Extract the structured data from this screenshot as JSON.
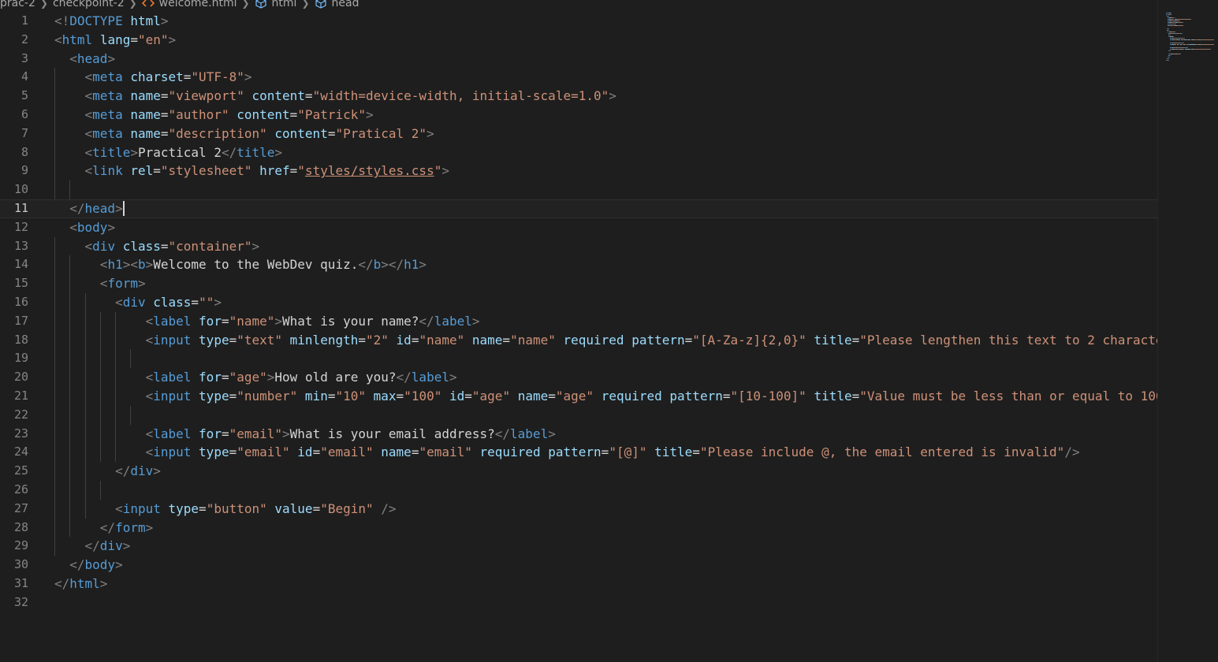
{
  "breadcrumb": [
    "prac-2",
    "checkpoint-2",
    "welcome.html",
    "html",
    "head"
  ],
  "icons": {
    "file": "html-file-icon",
    "symbol": "symbol-box-icon",
    "separator": "chevron-right-icon"
  },
  "colors": {
    "tag": "#569cd6",
    "attribute": "#9cdcfe",
    "string": "#ce9178",
    "text": "#d4d4d4",
    "bracket": "#808080",
    "background": "#1e1e1e"
  },
  "editor": {
    "active_line": 11,
    "lines": [
      [
        [
          "br",
          "<!"
        ],
        [
          "tag",
          "DOCTYPE"
        ],
        [
          "txt",
          " "
        ],
        [
          "attr",
          "html"
        ],
        [
          "br",
          ">"
        ]
      ],
      [
        [
          "br",
          "<"
        ],
        [
          "tag",
          "html"
        ],
        [
          "txt",
          " "
        ],
        [
          "attr",
          "lang"
        ],
        [
          "txt",
          "="
        ],
        [
          "str",
          "\"en\""
        ],
        [
          "br",
          ">"
        ]
      ],
      [
        [
          "txt",
          "  "
        ],
        [
          "br",
          "<"
        ],
        [
          "tag",
          "head"
        ],
        [
          "br",
          ">"
        ]
      ],
      [
        [
          "txt",
          "    "
        ],
        [
          "br",
          "<"
        ],
        [
          "tag",
          "meta"
        ],
        [
          "txt",
          " "
        ],
        [
          "attr",
          "charset"
        ],
        [
          "txt",
          "="
        ],
        [
          "str",
          "\"UTF-8\""
        ],
        [
          "br",
          ">"
        ]
      ],
      [
        [
          "txt",
          "    "
        ],
        [
          "br",
          "<"
        ],
        [
          "tag",
          "meta"
        ],
        [
          "txt",
          " "
        ],
        [
          "attr",
          "name"
        ],
        [
          "txt",
          "="
        ],
        [
          "str",
          "\"viewport\""
        ],
        [
          "txt",
          " "
        ],
        [
          "attr",
          "content"
        ],
        [
          "txt",
          "="
        ],
        [
          "str",
          "\"width=device-width, initial-scale=1.0\""
        ],
        [
          "br",
          ">"
        ]
      ],
      [
        [
          "txt",
          "    "
        ],
        [
          "br",
          "<"
        ],
        [
          "tag",
          "meta"
        ],
        [
          "txt",
          " "
        ],
        [
          "attr",
          "name"
        ],
        [
          "txt",
          "="
        ],
        [
          "str",
          "\"author\""
        ],
        [
          "txt",
          " "
        ],
        [
          "attr",
          "content"
        ],
        [
          "txt",
          "="
        ],
        [
          "str",
          "\"Patrick\""
        ],
        [
          "br",
          ">"
        ]
      ],
      [
        [
          "txt",
          "    "
        ],
        [
          "br",
          "<"
        ],
        [
          "tag",
          "meta"
        ],
        [
          "txt",
          " "
        ],
        [
          "attr",
          "name"
        ],
        [
          "txt",
          "="
        ],
        [
          "str",
          "\"description\""
        ],
        [
          "txt",
          " "
        ],
        [
          "attr",
          "content"
        ],
        [
          "txt",
          "="
        ],
        [
          "str",
          "\"Pratical 2\""
        ],
        [
          "br",
          ">"
        ]
      ],
      [
        [
          "txt",
          "    "
        ],
        [
          "br",
          "<"
        ],
        [
          "tag",
          "title"
        ],
        [
          "br",
          ">"
        ],
        [
          "txt",
          "Practical 2"
        ],
        [
          "br",
          "</"
        ],
        [
          "tag",
          "title"
        ],
        [
          "br",
          ">"
        ]
      ],
      [
        [
          "txt",
          "    "
        ],
        [
          "br",
          "<"
        ],
        [
          "tag",
          "link"
        ],
        [
          "txt",
          " "
        ],
        [
          "attr",
          "rel"
        ],
        [
          "txt",
          "="
        ],
        [
          "str",
          "\"stylesheet\""
        ],
        [
          "txt",
          " "
        ],
        [
          "attr",
          "href"
        ],
        [
          "txt",
          "="
        ],
        [
          "str",
          "\""
        ],
        [
          "link",
          "styles/styles.css"
        ],
        [
          "str",
          "\""
        ],
        [
          "br",
          ">"
        ]
      ],
      [],
      [
        [
          "txt",
          "  "
        ],
        [
          "br",
          "</"
        ],
        [
          "tag",
          "head"
        ],
        [
          "br",
          ">"
        ],
        [
          "caret",
          ""
        ]
      ],
      [
        [
          "txt",
          "  "
        ],
        [
          "br",
          "<"
        ],
        [
          "tag",
          "body"
        ],
        [
          "br",
          ">"
        ]
      ],
      [
        [
          "txt",
          "    "
        ],
        [
          "br",
          "<"
        ],
        [
          "tag",
          "div"
        ],
        [
          "txt",
          " "
        ],
        [
          "attr",
          "class"
        ],
        [
          "txt",
          "="
        ],
        [
          "str",
          "\"container\""
        ],
        [
          "br",
          ">"
        ]
      ],
      [
        [
          "txt",
          "      "
        ],
        [
          "br",
          "<"
        ],
        [
          "tag",
          "h1"
        ],
        [
          "br",
          "><"
        ],
        [
          "tag",
          "b"
        ],
        [
          "br",
          ">"
        ],
        [
          "txt",
          "Welcome to the WebDev quiz."
        ],
        [
          "br",
          "</"
        ],
        [
          "tag",
          "b"
        ],
        [
          "br",
          "></"
        ],
        [
          "tag",
          "h1"
        ],
        [
          "br",
          ">"
        ]
      ],
      [
        [
          "txt",
          "      "
        ],
        [
          "br",
          "<"
        ],
        [
          "tag",
          "form"
        ],
        [
          "br",
          ">"
        ]
      ],
      [
        [
          "txt",
          "        "
        ],
        [
          "br",
          "<"
        ],
        [
          "tag",
          "div"
        ],
        [
          "txt",
          " "
        ],
        [
          "attr",
          "class"
        ],
        [
          "txt",
          "="
        ],
        [
          "str",
          "\"\""
        ],
        [
          "br",
          ">"
        ]
      ],
      [
        [
          "txt",
          "            "
        ],
        [
          "br",
          "<"
        ],
        [
          "tag",
          "label"
        ],
        [
          "txt",
          " "
        ],
        [
          "attr",
          "for"
        ],
        [
          "txt",
          "="
        ],
        [
          "str",
          "\"name\""
        ],
        [
          "br",
          ">"
        ],
        [
          "txt",
          "What is your name?"
        ],
        [
          "br",
          "</"
        ],
        [
          "tag",
          "label"
        ],
        [
          "br",
          ">"
        ]
      ],
      [
        [
          "txt",
          "            "
        ],
        [
          "br",
          "<"
        ],
        [
          "tag",
          "input"
        ],
        [
          "txt",
          " "
        ],
        [
          "attr",
          "type"
        ],
        [
          "txt",
          "="
        ],
        [
          "str",
          "\"text\""
        ],
        [
          "txt",
          " "
        ],
        [
          "attr",
          "minlength"
        ],
        [
          "txt",
          "="
        ],
        [
          "str",
          "\"2\""
        ],
        [
          "txt",
          " "
        ],
        [
          "attr",
          "id"
        ],
        [
          "txt",
          "="
        ],
        [
          "str",
          "\"name\""
        ],
        [
          "txt",
          " "
        ],
        [
          "attr",
          "name"
        ],
        [
          "txt",
          "="
        ],
        [
          "str",
          "\"name\""
        ],
        [
          "txt",
          " "
        ],
        [
          "attr",
          "required"
        ],
        [
          "txt",
          " "
        ],
        [
          "attr",
          "pattern"
        ],
        [
          "txt",
          "="
        ],
        [
          "str",
          "\"[A-Za-z]{2,0}\""
        ],
        [
          "txt",
          " "
        ],
        [
          "attr",
          "title"
        ],
        [
          "txt",
          "="
        ],
        [
          "str",
          "\"Please lengthen this text to 2 characte"
        ]
      ],
      [],
      [
        [
          "txt",
          "            "
        ],
        [
          "br",
          "<"
        ],
        [
          "tag",
          "label"
        ],
        [
          "txt",
          " "
        ],
        [
          "attr",
          "for"
        ],
        [
          "txt",
          "="
        ],
        [
          "str",
          "\"age\""
        ],
        [
          "br",
          ">"
        ],
        [
          "txt",
          "How old are you?"
        ],
        [
          "br",
          "</"
        ],
        [
          "tag",
          "label"
        ],
        [
          "br",
          ">"
        ]
      ],
      [
        [
          "txt",
          "            "
        ],
        [
          "br",
          "<"
        ],
        [
          "tag",
          "input"
        ],
        [
          "txt",
          " "
        ],
        [
          "attr",
          "type"
        ],
        [
          "txt",
          "="
        ],
        [
          "str",
          "\"number\""
        ],
        [
          "txt",
          " "
        ],
        [
          "attr",
          "min"
        ],
        [
          "txt",
          "="
        ],
        [
          "str",
          "\"10\""
        ],
        [
          "txt",
          " "
        ],
        [
          "attr",
          "max"
        ],
        [
          "txt",
          "="
        ],
        [
          "str",
          "\"100\""
        ],
        [
          "txt",
          " "
        ],
        [
          "attr",
          "id"
        ],
        [
          "txt",
          "="
        ],
        [
          "str",
          "\"age\""
        ],
        [
          "txt",
          " "
        ],
        [
          "attr",
          "name"
        ],
        [
          "txt",
          "="
        ],
        [
          "str",
          "\"age\""
        ],
        [
          "txt",
          " "
        ],
        [
          "attr",
          "required"
        ],
        [
          "txt",
          " "
        ],
        [
          "attr",
          "pattern"
        ],
        [
          "txt",
          "="
        ],
        [
          "str",
          "\"[10-100]\""
        ],
        [
          "txt",
          " "
        ],
        [
          "attr",
          "title"
        ],
        [
          "txt",
          "="
        ],
        [
          "str",
          "\"Value must be less than or equal to 100"
        ]
      ],
      [],
      [
        [
          "txt",
          "            "
        ],
        [
          "br",
          "<"
        ],
        [
          "tag",
          "label"
        ],
        [
          "txt",
          " "
        ],
        [
          "attr",
          "for"
        ],
        [
          "txt",
          "="
        ],
        [
          "str",
          "\"email\""
        ],
        [
          "br",
          ">"
        ],
        [
          "txt",
          "What is your email address?"
        ],
        [
          "br",
          "</"
        ],
        [
          "tag",
          "label"
        ],
        [
          "br",
          ">"
        ]
      ],
      [
        [
          "txt",
          "            "
        ],
        [
          "br",
          "<"
        ],
        [
          "tag",
          "input"
        ],
        [
          "txt",
          " "
        ],
        [
          "attr",
          "type"
        ],
        [
          "txt",
          "="
        ],
        [
          "str",
          "\"email\""
        ],
        [
          "txt",
          " "
        ],
        [
          "attr",
          "id"
        ],
        [
          "txt",
          "="
        ],
        [
          "str",
          "\"email\""
        ],
        [
          "txt",
          " "
        ],
        [
          "attr",
          "name"
        ],
        [
          "txt",
          "="
        ],
        [
          "str",
          "\"email\""
        ],
        [
          "txt",
          " "
        ],
        [
          "attr",
          "required"
        ],
        [
          "txt",
          " "
        ],
        [
          "attr",
          "pattern"
        ],
        [
          "txt",
          "="
        ],
        [
          "str",
          "\"[@]\""
        ],
        [
          "txt",
          " "
        ],
        [
          "attr",
          "title"
        ],
        [
          "txt",
          "="
        ],
        [
          "str",
          "\"Please include @, the email entered is invalid\""
        ],
        [
          "br",
          "/>"
        ]
      ],
      [
        [
          "txt",
          "        "
        ],
        [
          "br",
          "</"
        ],
        [
          "tag",
          "div"
        ],
        [
          "br",
          ">"
        ]
      ],
      [],
      [
        [
          "txt",
          "        "
        ],
        [
          "br",
          "<"
        ],
        [
          "tag",
          "input"
        ],
        [
          "txt",
          " "
        ],
        [
          "attr",
          "type"
        ],
        [
          "txt",
          "="
        ],
        [
          "str",
          "\"button\""
        ],
        [
          "txt",
          " "
        ],
        [
          "attr",
          "value"
        ],
        [
          "txt",
          "="
        ],
        [
          "str",
          "\"Begin\""
        ],
        [
          "txt",
          " "
        ],
        [
          "br",
          "/>"
        ]
      ],
      [
        [
          "txt",
          "      "
        ],
        [
          "br",
          "</"
        ],
        [
          "tag",
          "form"
        ],
        [
          "br",
          ">"
        ]
      ],
      [
        [
          "txt",
          "    "
        ],
        [
          "br",
          "</"
        ],
        [
          "tag",
          "div"
        ],
        [
          "br",
          ">"
        ]
      ],
      [
        [
          "txt",
          "  "
        ],
        [
          "br",
          "</"
        ],
        [
          "tag",
          "body"
        ],
        [
          "br",
          ">"
        ]
      ],
      [
        [
          "br",
          "</"
        ],
        [
          "tag",
          "html"
        ],
        [
          "br",
          ">"
        ]
      ],
      []
    ]
  }
}
